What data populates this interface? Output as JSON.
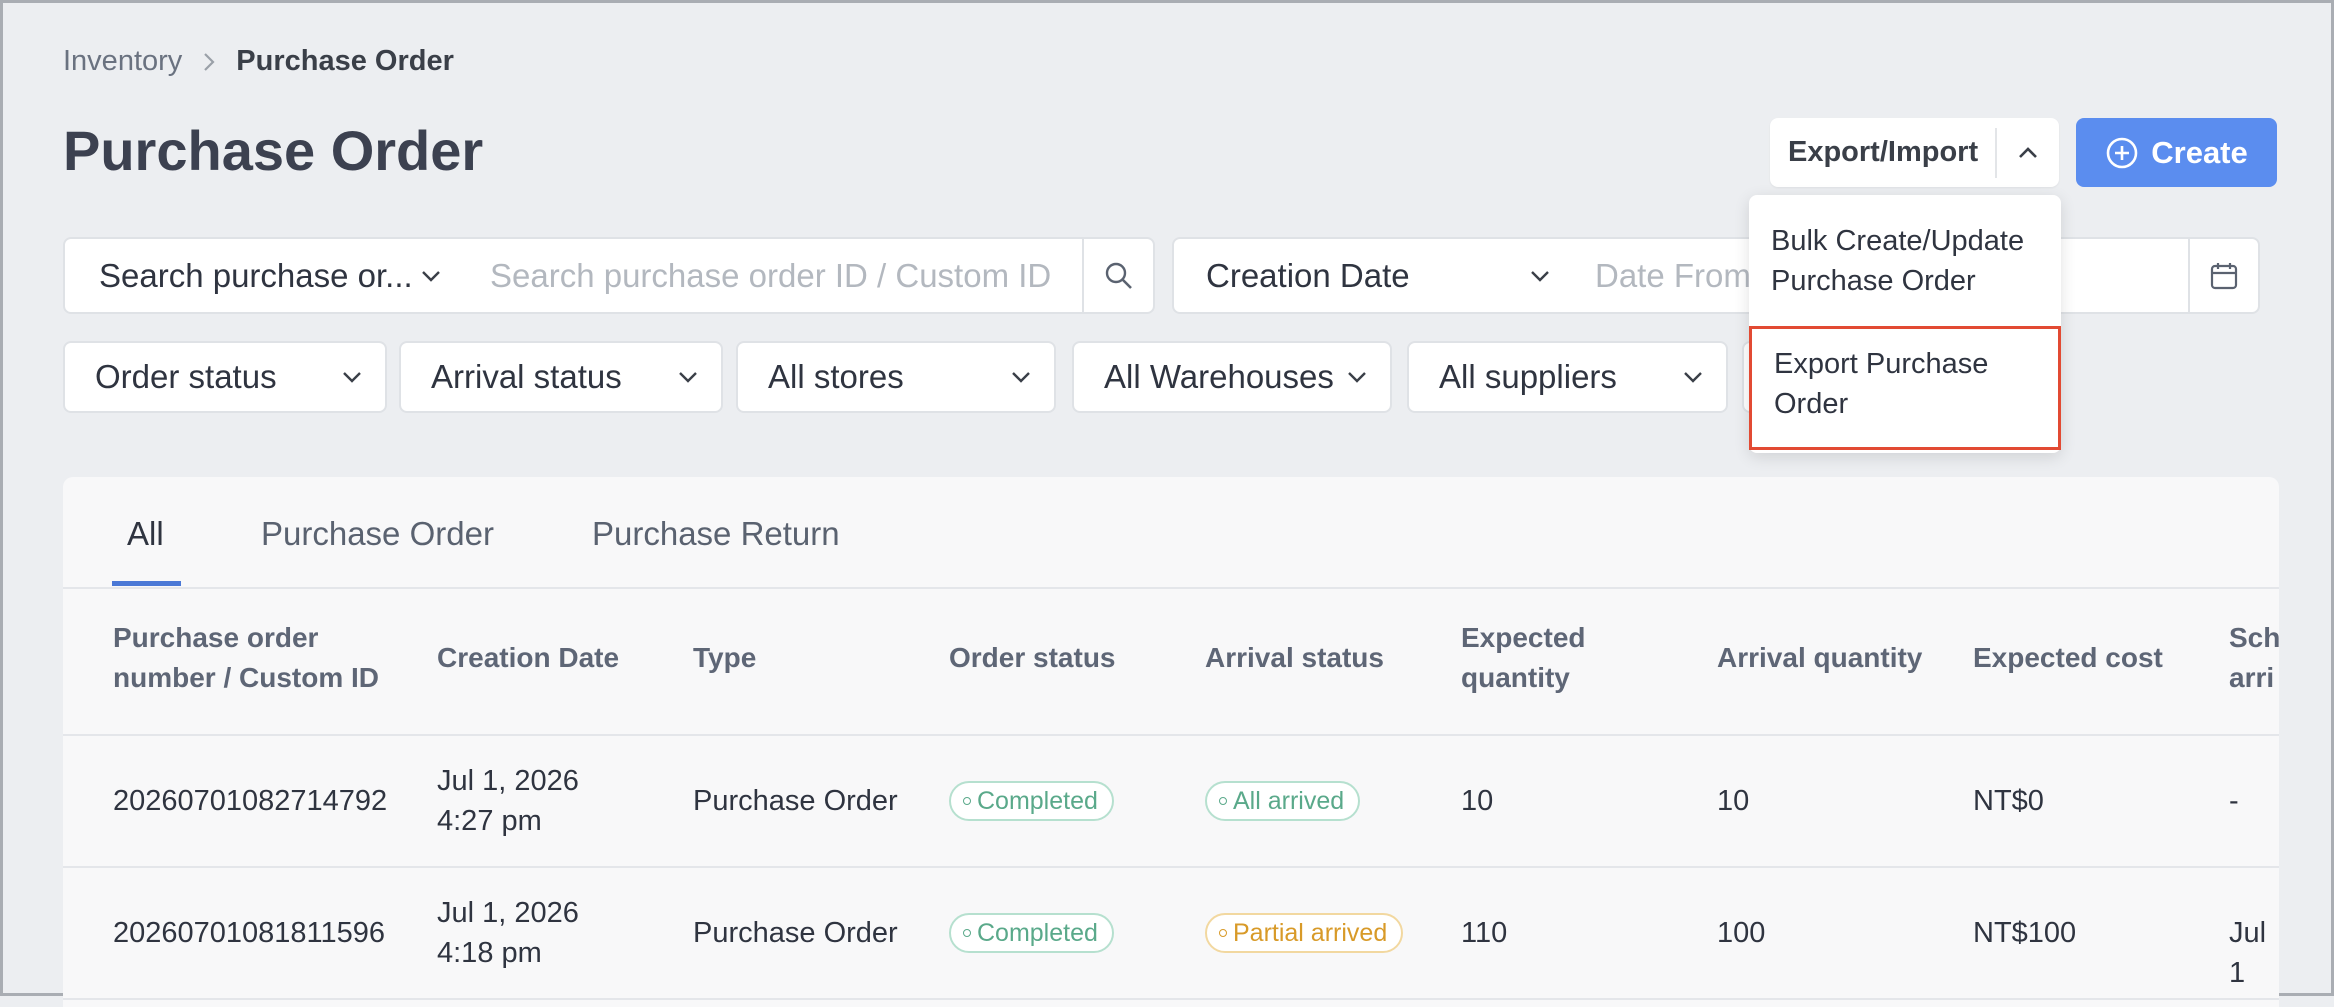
{
  "breadcrumb": {
    "parent": "Inventory",
    "current": "Purchase Order"
  },
  "page_title": "Purchase Order",
  "toolbar": {
    "export_import_label": "Export/Import",
    "create_label": "Create"
  },
  "export_menu": {
    "items": [
      "Bulk Create/Update Purchase Order",
      "Export Purchase Order"
    ]
  },
  "search": {
    "type_label": "Search purchase or...",
    "placeholder": "Search purchase order ID / Custom ID"
  },
  "date_filter": {
    "type_label": "Creation Date",
    "placeholder": "Date From"
  },
  "filters": [
    "Order status",
    "Arrival status",
    "All stores",
    "All Warehouses",
    "All suppliers"
  ],
  "tabs": [
    "All",
    "Purchase Order",
    "Purchase Return"
  ],
  "table": {
    "columns": [
      "Purchase order number / Custom ID",
      "Creation Date",
      "Type",
      "Order status",
      "Arrival status",
      "Expected quantity",
      "Arrival quantity",
      "Expected cost",
      "Sch arri"
    ],
    "rows": [
      {
        "number": "20260701082714792",
        "date": "Jul 1, 2026",
        "time": "4:27 pm",
        "type": "Purchase Order",
        "order_status": "Completed",
        "arrival_status": "All arrived",
        "expected_qty": "10",
        "arrival_qty": "10",
        "expected_cost": "NT$0",
        "scheduled": "-"
      },
      {
        "number": "20260701081811596",
        "date": "Jul 1, 2026",
        "time": "4:18 pm",
        "type": "Purchase Order",
        "order_status": "Completed",
        "arrival_status": "Partial arrived",
        "expected_qty": "110",
        "arrival_qty": "100",
        "expected_cost": "NT$100",
        "scheduled": "Jul 1"
      }
    ]
  },
  "colors": {
    "accent": "#5b8def",
    "highlight": "#e24a33",
    "status_green": "#5aa98a",
    "status_orange": "#d89a28"
  }
}
